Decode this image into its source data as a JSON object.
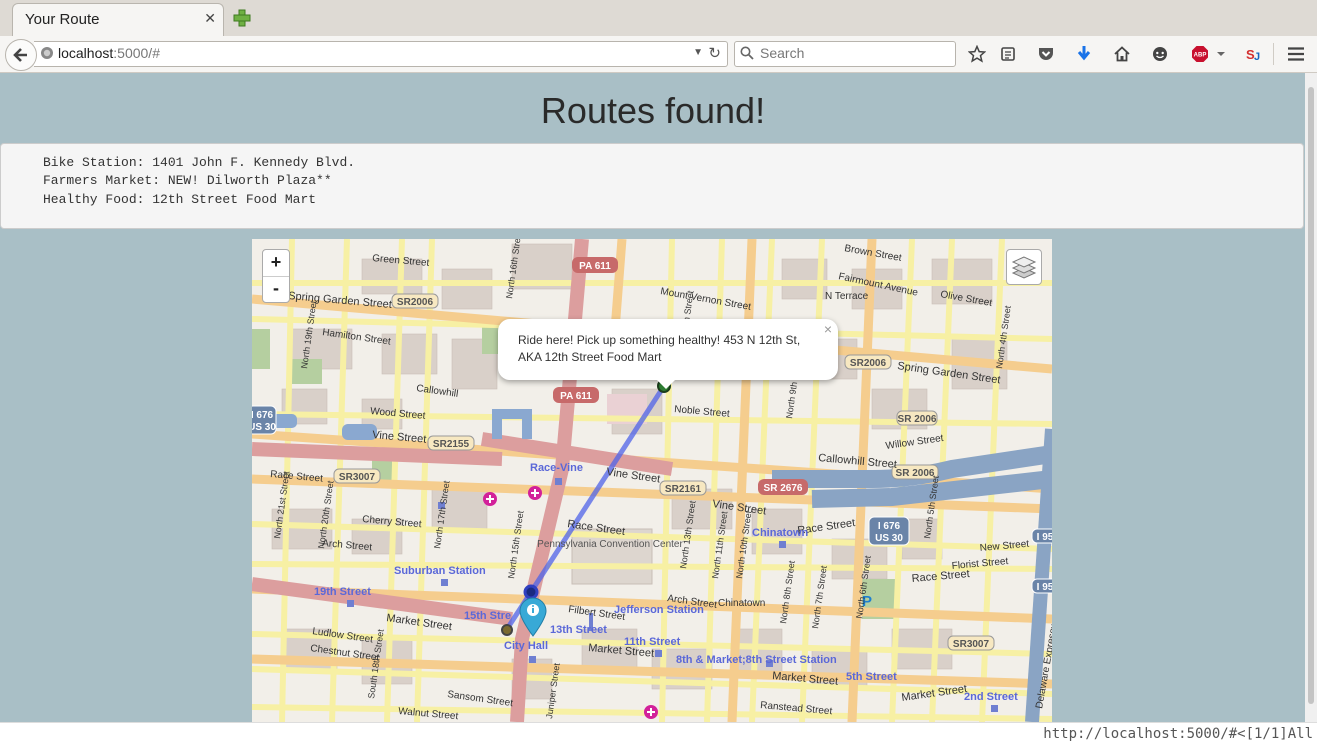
{
  "browser": {
    "tab_title": "Your Route",
    "url_host": "localhost",
    "url_rest": ":5000/#",
    "search_placeholder": "Search"
  },
  "page": {
    "title": "Routes found!",
    "info_lines": [
      "Bike Station: 1401 John F. Kennedy Blvd.",
      "Farmers Market: NEW! Dilworth Plaza**",
      "Healthy Food: 12th Street Food Mart"
    ]
  },
  "map": {
    "zoom_in": "+",
    "zoom_out": "-",
    "popup_text": "Ride here! Pick up something healthy! 453 N 12th St, AKA 12th Street Food Mart",
    "popup_close": "×",
    "route_color": "#4f63e8",
    "labels": {
      "pa611_top": "PA 611",
      "pa611_mid": "PA 611",
      "sr2006_left": "SR2006",
      "sr2006_right": "SR2006",
      "sr2155": "SR2155",
      "sr3007_left": "SR3007",
      "sr3007_right": "SR3007",
      "sr2161": "SR2161",
      "sr2676": "SR 2676",
      "sr2006_mid": "SR 2006",
      "sr2006_b": "SR 2006",
      "i676": "I 676",
      "us30": "US 30",
      "spring_garden_w": "Spring Garden Street",
      "spring_garden_e": "Spring Garden Street",
      "green_street": "Green Street",
      "mount_vernon": "Mount Vernon Street",
      "hamilton": "Hamilton Street",
      "callowhill_w": "Callowhill",
      "callowhill_e": "Callowhill Street",
      "wood_street": "Wood Street",
      "vine_w": "Vine Street",
      "vine_mid": "Vine Street",
      "vine_e": "Vine Street",
      "race_vine": "Race-Vine",
      "race_street": "Race Street",
      "race_e": "Race Street",
      "race_w": "Race Street",
      "arch_street": "Arch Street",
      "arch_mid": "Arch Street",
      "cherry_street": "Cherry Street",
      "filbert": "Filbert Street",
      "market_w": "Market Street",
      "market_mid": "Market Street",
      "market_e": "Market Street",
      "chinatown_top": "Chinatown",
      "chinatown_bottom": "Chinatown",
      "convention": "Pennsylvania Convention Center",
      "suburban": "Suburban Station",
      "nineteenth": "19th Street",
      "fifteenth": "15th Stre",
      "thirteenth": "13th Street",
      "city_hall": "City Hall",
      "jefferson": "Jefferson Station",
      "eleventh": "11th Street",
      "eighth": "8th & Market;8th Street Station",
      "fifth": "5th Street",
      "second": "2nd Street",
      "ludlow": "Ludlow Street",
      "chestnut": "Chestnut Street",
      "sansom": "Sansom Street",
      "walnut": "Walnut Street",
      "ranstead": "Ranstead Street",
      "noble": "Noble Street",
      "willow": "Willow Street",
      "florist": "Florist Street",
      "new_street": "New Street",
      "n_terrace": "N Terrace",
      "fairmount": "Fairmount Avenue",
      "olive": "Olive Street",
      "brown": "Brown Street",
      "delaware": "Delaware Expressway",
      "parking": "P",
      "i95": "I 95",
      "n_13th": "North 13th Street",
      "n_12th": "North 12th Street",
      "n_11th": "North 11th Street",
      "n_10th": "North 10th Street",
      "n_9th": "North 9th Street",
      "n_8th": "North 8th Street",
      "n_7th": "North 7th Street",
      "n_6th": "North 6th Street",
      "n_5th": "North 5th Street",
      "n_4th": "North 4th Street",
      "n_15th": "North 15th Street",
      "n_16th": "North 16th Street",
      "n_17th": "North 17th Street",
      "n_19th": "North 19th Street",
      "n_20th": "North 20th Street",
      "n_21st": "North 21st Street",
      "s_18th": "South 18th Street",
      "juniper": "Juniper Street"
    }
  },
  "statusbar": {
    "text": "http://localhost:5000/#<[1/1]All"
  }
}
